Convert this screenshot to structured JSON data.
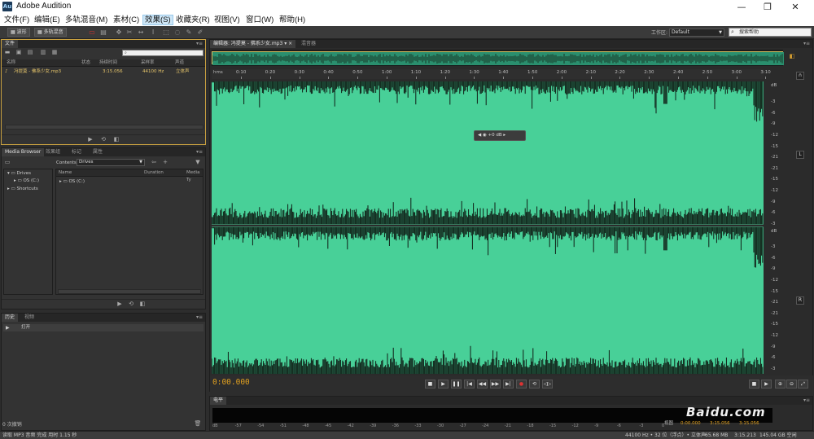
{
  "window": {
    "app_icon": "Au",
    "title": "Adobe Audition",
    "controls": [
      "—",
      "❐",
      "✕"
    ]
  },
  "menu": [
    "文件(F)",
    "编辑(E)",
    "多轨混音(M)",
    "素材(C)",
    "效果(S)",
    "收藏夹(R)",
    "视图(V)",
    "窗口(W)",
    "帮助(H)"
  ],
  "toolbar": {
    "waveform_label": "波形",
    "multitrack_label": "多轨混音",
    "workspace_label": "工作区:",
    "workspace_value": "Default",
    "help_placeholder": "搜索帮助"
  },
  "files_panel": {
    "tab": "文件",
    "columns": [
      "名称",
      "状态",
      "持续时间",
      "采样率",
      "声道"
    ],
    "rows": [
      {
        "name": "冯提莫 - 佛系少女.mp3",
        "duration": "3:15.056",
        "rate": "44100 Hz",
        "channels": "立体声"
      }
    ]
  },
  "media_panel": {
    "tabs": [
      "Media Browser",
      "效果组",
      "标记",
      "属性"
    ],
    "contents_label": "Contents:",
    "contents_value": "Drives",
    "tree": [
      "Drives",
      "OS (C:)",
      "Shortcuts"
    ],
    "columns": [
      "Name",
      "Duration",
      "Media Ty"
    ],
    "list": [
      "OS (C:)"
    ]
  },
  "history_panel": {
    "tabs": [
      "历史",
      "视频"
    ],
    "items": [
      "打开"
    ],
    "undo_count": "0 次撤销"
  },
  "editor": {
    "tabs": [
      "编辑器: 冯提莫 - 佛系少女.mp3",
      "混音器"
    ],
    "ruler_unit": "hms",
    "ruler_ticks": [
      "0:10",
      "0:20",
      "0:30",
      "0:40",
      "0:50",
      "1:00",
      "1:10",
      "1:20",
      "1:30",
      "1:40",
      "1:50",
      "2:00",
      "2:10",
      "2:20",
      "2:30",
      "2:40",
      "2:50",
      "3:00",
      "3:10"
    ],
    "hud_value": "+0 dB",
    "db_unit": "dB",
    "db_labels_top": [
      "-3",
      "-6",
      "-9",
      "-12",
      "-15",
      "-21",
      "-21",
      "-15",
      "-12",
      "-9",
      "-6",
      "-3"
    ],
    "db_labels_bottom": [
      "-3",
      "-6",
      "-9",
      "-12",
      "-15",
      "-21",
      "-21",
      "-15",
      "-12",
      "-9",
      "-6",
      "-3"
    ],
    "channel_top": "L",
    "channel_bottom": "R",
    "current_time": "0:00.000"
  },
  "meter_panel": {
    "tab": "电平",
    "scale": [
      "dB",
      "-57",
      "-54",
      "-51",
      "-48",
      "-45",
      "-42",
      "-39",
      "-36",
      "-33",
      "-30",
      "-27",
      "-24",
      "-21",
      "-18",
      "-15",
      "-12",
      "-9",
      "-6",
      "-3",
      "0"
    ],
    "selection_label": "视图",
    "sel_start": "0:00.000",
    "sel_end": "3:15.056",
    "sel_duration": "3:15.056",
    "watermark": "Baidu.com"
  },
  "status": {
    "message": "读取 MP3 音频 完成 用时 1.15 秒",
    "format": "44100 Hz • 32 位（浮点）• 立体声",
    "size": "65.68 MB",
    "duration": "3:15.213",
    "free": "145.04 GB 空闲"
  },
  "colors": {
    "waveform_bg": "#48d098",
    "waveform_fg": "#101d16",
    "time": "#e0a020",
    "files_border": "#c8a040"
  }
}
